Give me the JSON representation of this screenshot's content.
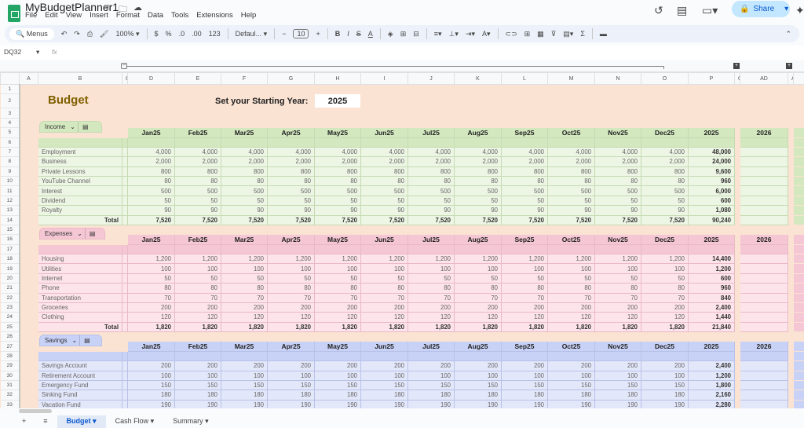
{
  "app": {
    "title": "MyBudgetPlanner1",
    "menus": [
      "File",
      "Edit",
      "View",
      "Insert",
      "Format",
      "Data",
      "Tools",
      "Extensions",
      "Help"
    ],
    "share_label": "Share"
  },
  "toolbar": {
    "search_label": "Menus",
    "zoom": "100%",
    "currency": "$",
    "percent": "%",
    "dec_less": ".0",
    "dec_more": ".00",
    "number_format": "123",
    "font": "Defaul...",
    "font_size": "10"
  },
  "formula_bar": {
    "cell_ref": "DQ32",
    "fx": "fx",
    "value": ""
  },
  "columns": [
    "A",
    "B",
    "C",
    "D",
    "E",
    "F",
    "G",
    "H",
    "I",
    "J",
    "K",
    "L",
    "M",
    "N",
    "O",
    "P",
    "Q",
    "AD",
    "AE"
  ],
  "sheet": {
    "title": "Budget",
    "starting_year_label": "Set your Starting Year:",
    "starting_year": "2025",
    "months": [
      "Jan25",
      "Feb25",
      "Mar25",
      "Apr25",
      "May25",
      "Jun25",
      "Jul25",
      "Aug25",
      "Sep25",
      "Oct25",
      "Nov25",
      "Dec25"
    ],
    "year_col": "2025",
    "next_year_col": "2026",
    "total_label": "Total",
    "sections": [
      {
        "name": "Income",
        "colors": {
          "header": "#d3e8bf",
          "row": "#edf5e4",
          "border": "#c5dbb3"
        },
        "items": [
          {
            "name": "Employment",
            "monthly": "4,000",
            "year": "48,000"
          },
          {
            "name": "Business",
            "monthly": "2,000",
            "year": "24,000"
          },
          {
            "name": "Private Lessons",
            "monthly": "800",
            "year": "9,600"
          },
          {
            "name": "YouTube Channel",
            "monthly": "80",
            "year": "960"
          },
          {
            "name": "Interest",
            "monthly": "500",
            "year": "6,000"
          },
          {
            "name": "Dividend",
            "monthly": "50",
            "year": "600"
          },
          {
            "name": "Royalty",
            "monthly": "90",
            "year": "1,080"
          }
        ],
        "total": {
          "monthly": "7,520",
          "year": "90,240"
        }
      },
      {
        "name": "Expenses",
        "colors": {
          "header": "#f5c6d4",
          "row": "#fde3ea",
          "border": "#e9b9c6"
        },
        "items": [
          {
            "name": "Housing",
            "monthly": "1,200",
            "year": "14,400"
          },
          {
            "name": "Utilities",
            "monthly": "100",
            "year": "1,200"
          },
          {
            "name": "Internet",
            "monthly": "50",
            "year": "600"
          },
          {
            "name": "Phone",
            "monthly": "80",
            "year": "960"
          },
          {
            "name": "Transportation",
            "monthly": "70",
            "year": "840"
          },
          {
            "name": "Groceries",
            "monthly": "200",
            "year": "2,400"
          },
          {
            "name": "Clothing",
            "monthly": "120",
            "year": "1,440"
          }
        ],
        "total": {
          "monthly": "1,820",
          "year": "21,840"
        }
      },
      {
        "name": "Savings",
        "colors": {
          "header": "#c8d1f6",
          "row": "#e3e7fa",
          "border": "#b8c2e8"
        },
        "items": [
          {
            "name": "Savings Account",
            "monthly": "200",
            "year": "2,400"
          },
          {
            "name": "Retirement Account",
            "monthly": "100",
            "year": "1,200"
          },
          {
            "name": "Emergency Fund",
            "monthly": "150",
            "year": "1,800"
          },
          {
            "name": "Sinking Fund",
            "monthly": "180",
            "year": "2,160"
          },
          {
            "name": "Vacation Fund",
            "monthly": "190",
            "year": "2,280"
          }
        ],
        "total": null
      }
    ]
  },
  "sheet_tabs": [
    {
      "label": "Budget",
      "active": true
    },
    {
      "label": "Cash Flow",
      "active": false
    },
    {
      "label": "Summary",
      "active": false
    }
  ]
}
